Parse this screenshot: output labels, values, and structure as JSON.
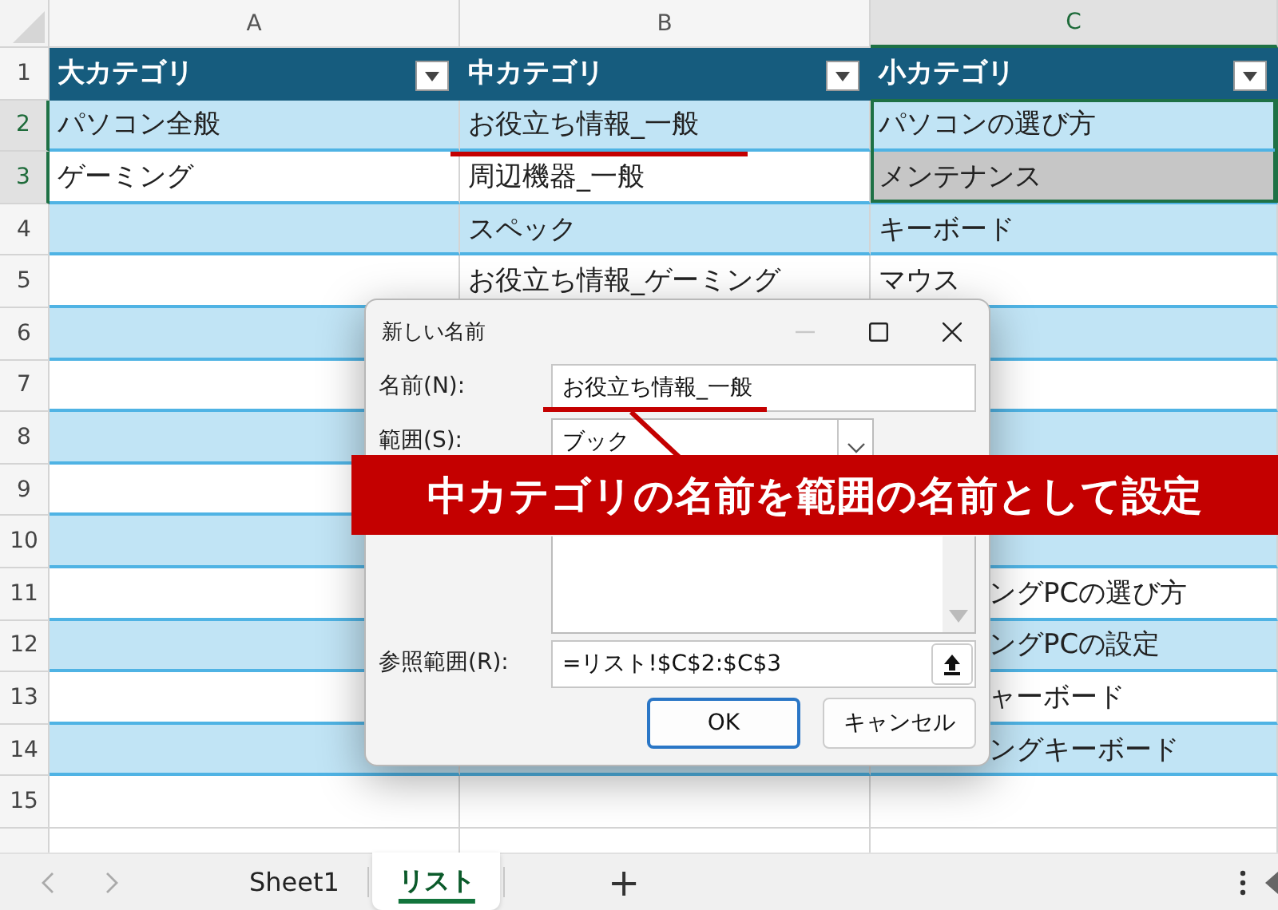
{
  "columns": [
    {
      "label": "A",
      "selected": false
    },
    {
      "label": "B",
      "selected": false
    },
    {
      "label": "C",
      "selected": true
    }
  ],
  "rows": [
    {
      "number": "1",
      "selected": false,
      "kind": "header",
      "cells": [
        {
          "text": "大カテゴリ",
          "selected": false
        },
        {
          "text": "中カテゴリ",
          "selected": false
        },
        {
          "text": "小カテゴリ",
          "selected": false
        }
      ]
    },
    {
      "number": "2",
      "selected": true,
      "kind": "shaded",
      "cells": [
        {
          "text": "パソコン全般",
          "selected": false
        },
        {
          "text": "お役立ち情報_一般",
          "selected": false
        },
        {
          "text": "パソコンの選び方",
          "selected": true
        }
      ]
    },
    {
      "number": "3",
      "selected": true,
      "kind": "plain",
      "cells": [
        {
          "text": "ゲーミング",
          "selected": false
        },
        {
          "text": "周辺機器_一般",
          "selected": false
        },
        {
          "text": "メンテナンス",
          "selected": true
        }
      ]
    },
    {
      "number": "4",
      "selected": false,
      "kind": "shaded",
      "cells": [
        {
          "selected": false
        },
        {
          "text": "スペック",
          "selected": false
        },
        {
          "text": "キーボード",
          "selected": false
        }
      ]
    },
    {
      "number": "5",
      "selected": false,
      "kind": "plain",
      "cells": [
        {
          "selected": false
        },
        {
          "text": "お役立ち情報_ゲーミング",
          "selected": false
        },
        {
          "text": "マウス",
          "selected": false
        }
      ]
    },
    {
      "number": "6",
      "selected": false,
      "kind": "shaded",
      "cells": [
        {
          "selected": false
        },
        null,
        {
          "selected": false
        }
      ]
    },
    {
      "number": "7",
      "selected": false,
      "kind": "plain",
      "cells": [
        {
          "selected": false
        },
        null,
        {
          "selected": false
        }
      ]
    },
    {
      "number": "8",
      "selected": false,
      "kind": "shaded",
      "cells": [
        {
          "selected": false
        },
        null,
        {
          "selected": false
        }
      ]
    },
    {
      "number": "9",
      "selected": false,
      "kind": "plain",
      "cells": [
        {
          "selected": false
        },
        null,
        null
      ]
    },
    {
      "number": "10",
      "selected": false,
      "kind": "shaded",
      "cells": [
        {
          "selected": false
        },
        null,
        {
          "selected": false
        }
      ]
    },
    {
      "number": "11",
      "selected": false,
      "kind": "plain",
      "cells": [
        {
          "selected": false
        },
        null,
        {
          "text": "ングPCの選び方",
          "selected": false,
          "covered": true
        }
      ]
    },
    {
      "number": "12",
      "selected": false,
      "kind": "shaded",
      "cells": [
        {
          "selected": false
        },
        null,
        {
          "text": "ングPCの設定",
          "selected": false,
          "covered": true
        }
      ]
    },
    {
      "number": "13",
      "selected": false,
      "kind": "plain",
      "cells": [
        {
          "selected": false
        },
        null,
        {
          "text": "ャーボード",
          "selected": false,
          "covered": true
        }
      ]
    },
    {
      "number": "14",
      "selected": false,
      "kind": "shaded",
      "cells": [
        {
          "selected": false
        },
        null,
        {
          "text": "ングキーボード",
          "selected": false,
          "covered": true
        }
      ]
    },
    {
      "number": "15",
      "selected": false,
      "kind": "blank",
      "cells": [
        {
          "selected": false
        },
        {
          "selected": false
        },
        {
          "selected": false
        }
      ]
    }
  ],
  "dialog": {
    "title": "新しい名前",
    "name": {
      "label": "名前(N):",
      "value": "お役立ち情報_一般"
    },
    "scope": {
      "label": "範囲(S):",
      "value": "ブック"
    },
    "refers_to": {
      "label": "参照範囲(R):",
      "value": "=リスト!$C$2:$C$3"
    },
    "buttons": [
      "OK",
      "キャンセル"
    ]
  },
  "annotation": {
    "text": "中カテゴリの名前を範囲の名前として設定"
  },
  "sheet_tabs": [
    {
      "label": "Sheet1",
      "selected": false
    },
    {
      "label": "リスト",
      "selected": true
    }
  ],
  "add_sheet": "+"
}
